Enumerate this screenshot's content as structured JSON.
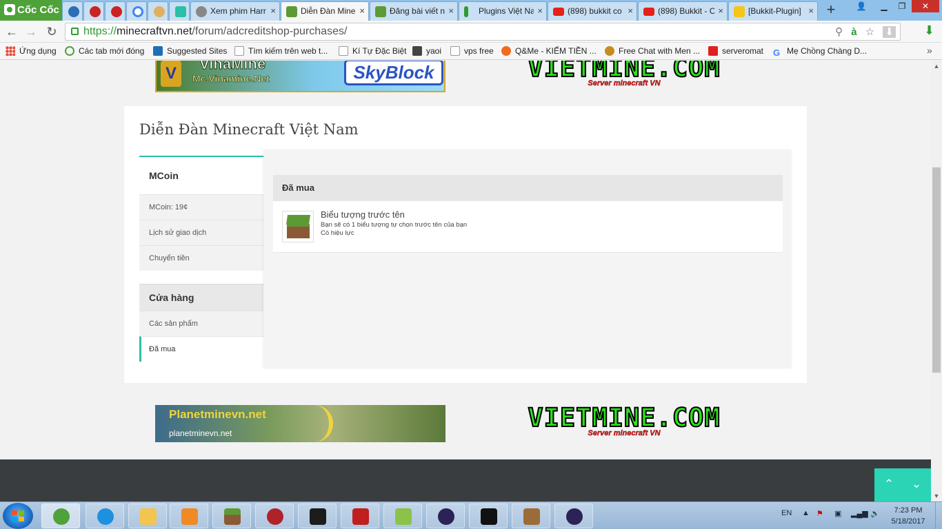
{
  "browser": {
    "brand": "Cốc Cốc",
    "tabs": [
      {
        "label": "",
        "fav_color": "#2b6fb8"
      },
      {
        "label": "",
        "fav_color": "#cc2222"
      },
      {
        "label": "",
        "fav_color": "#cc2222"
      },
      {
        "label": "",
        "fav_color": "#4285f4"
      },
      {
        "label": "",
        "fav_color": "#e0b060"
      },
      {
        "label": "",
        "fav_color": "#2bbfa8"
      },
      {
        "label": "Xem phim Harr",
        "fav_color": "#888888"
      },
      {
        "label": "Diễn Đàn Mine",
        "fav_color": "#5c9a36"
      },
      {
        "label": "Đăng bài viết n",
        "fav_color": "#5c9a36"
      },
      {
        "label": "Plugins Việt Na",
        "fav_color": "#2e9b32"
      },
      {
        "label": "(898) bukkit co",
        "fav_color": "#e62117"
      },
      {
        "label": "(898) Bukkit - C",
        "fav_color": "#e62117"
      },
      {
        "label": "[Bukkit-Plugin]",
        "fav_color": "#f5c518"
      }
    ],
    "url": {
      "scheme": "https://",
      "host": "minecraftvn.net",
      "path": "/forum/adcreditshop-purchases/"
    },
    "bookmarks": [
      {
        "label": "Ứng dụng",
        "icon": "apps-icon"
      },
      {
        "label": "Các tab mới đóng",
        "icon_color": "#4fa23a"
      },
      {
        "label": "Suggested Sites",
        "icon_color": "#1e6fb8"
      },
      {
        "label": "Tìm kiếm trên web t...",
        "icon_color": "#dddddd"
      },
      {
        "label": "Kí Tự Đặc Biệt",
        "icon_color": "#dddddd"
      },
      {
        "label": "yaoi",
        "icon_color": "#444444"
      },
      {
        "label": "vps free",
        "icon_color": "#dddddd"
      },
      {
        "label": "Q&Me - KIẾM TIỀN ...",
        "icon_color": "#f26b1d"
      },
      {
        "label": "Free Chat with Men ...",
        "icon_color": "#c78c1e"
      },
      {
        "label": "serveromat",
        "icon_color": "#e02020"
      },
      {
        "label": "Mẹ Chồng Chàng D...",
        "icon_color": "#4285f4"
      }
    ]
  },
  "page": {
    "banner_top_left": {
      "title": "VinaMine",
      "subtitle": "Mc.Vinamine.Net",
      "badge": "SkyBlock",
      "logo": "V"
    },
    "banner_vietmine": {
      "title": "VIETMINE.COM",
      "subtitle": "Server minecraft VN"
    },
    "forum_title": "Diễn Đàn Minecraft Việt Nam",
    "sidebar": {
      "mcoin": {
        "heading": "MCoin",
        "items": [
          "MCoin: 19¢",
          "Lịch sử giao dịch",
          "Chuyển tiền"
        ]
      },
      "shop": {
        "heading": "Cửa hàng",
        "items": [
          "Các sản phẩm",
          "Đã mua"
        ]
      }
    },
    "main": {
      "heading": "Đã mua",
      "product": {
        "title": "Biểu tượng trước tên",
        "description": "Bạn sẽ có 1 biểu tượng tự chọn trước tên của bạn",
        "status": "Có hiệu lực"
      }
    },
    "banner_bottom_left": {
      "title": "Planetminevn.net",
      "url": "planetminevn.net"
    },
    "scroll_up": "⌃",
    "scroll_down": "⌄"
  },
  "taskbar": {
    "language": "EN",
    "time": "7:23 PM",
    "date": "5/18/2017",
    "apps": [
      "coccoc-icon",
      "ie-icon",
      "explorer-icon",
      "media-icon",
      "minecraft-icon",
      "crossfire-icon",
      "cc-icon",
      "filezilla-icon",
      "notepadpp-icon",
      "eclipse-icon",
      "cmd-icon",
      "craftingtable-icon",
      "eclipse-icon"
    ]
  },
  "colors": {
    "accent": "#2bbfa8",
    "vietmine_green": "#2ee01e",
    "planet_yellow": "#f1d43c"
  }
}
